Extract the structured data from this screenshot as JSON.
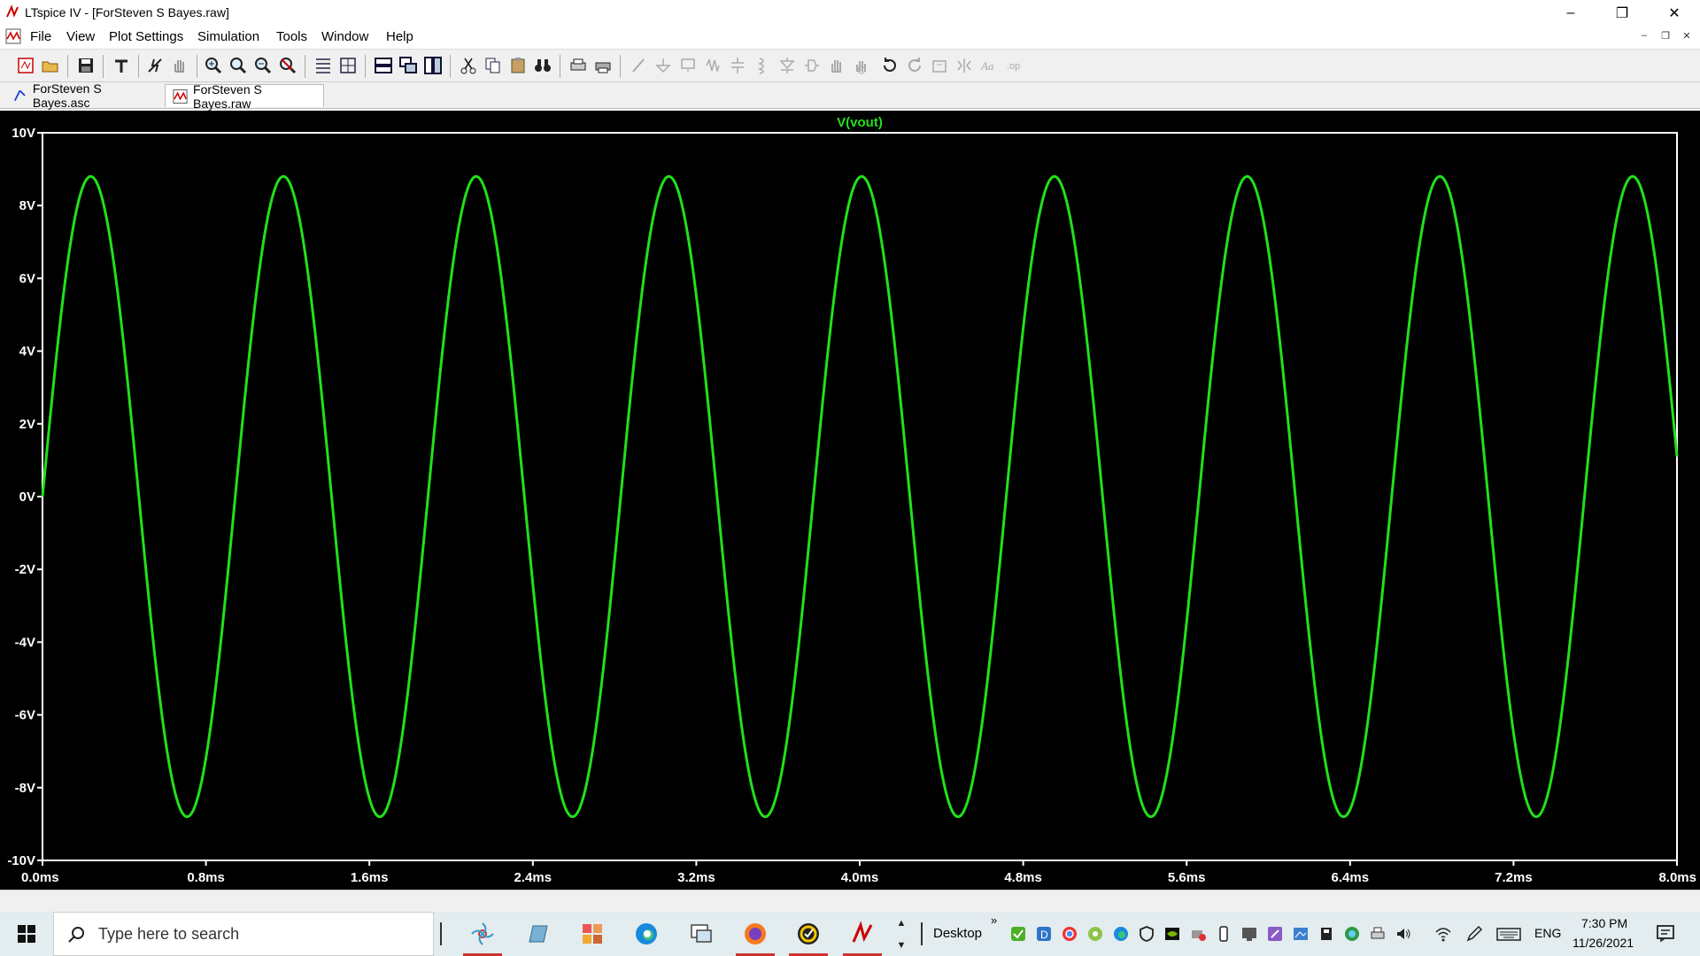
{
  "window": {
    "title": "LTspice IV - [ForSteven S Bayes.raw]",
    "controls": {
      "minimize": "–",
      "restore": "❐",
      "close": "✕"
    }
  },
  "menu": [
    "File",
    "View",
    "Plot Settings",
    "Simulation",
    "Tools",
    "Window",
    "Help"
  ],
  "mdi_controls": {
    "minimize": "–",
    "restore": "❐",
    "close": "✕"
  },
  "tabs": [
    {
      "label": "ForSteven S Bayes.asc",
      "icon": "schematic-icon",
      "active": false
    },
    {
      "label": "ForSteven S Bayes.raw",
      "icon": "waveform-icon",
      "active": true
    }
  ],
  "colors": {
    "trace": "#22e01a",
    "plot_bg": "#000000",
    "axis": "#ffffff",
    "title_text": "#22e01a"
  },
  "chart_data": {
    "type": "line",
    "title": "V(vout)",
    "series": [
      {
        "name": "V(vout)",
        "waveform": "sine",
        "amplitude_v": 8.8,
        "frequency_hz": 1060,
        "phase_deg": 0,
        "offset_v": 0
      }
    ],
    "x_range_ms": [
      0,
      8.0
    ],
    "y_range_v": [
      -10,
      10
    ],
    "x_ticks": [
      "0.0ms",
      "0.8ms",
      "1.6ms",
      "2.4ms",
      "3.2ms",
      "4.0ms",
      "4.8ms",
      "5.6ms",
      "6.4ms",
      "7.2ms",
      "8.0ms"
    ],
    "y_ticks": [
      "10V",
      "8V",
      "6V",
      "4V",
      "2V",
      "0V",
      "-2V",
      "-4V",
      "-6V",
      "-8V",
      "-10V"
    ],
    "grid": false
  },
  "taskbar": {
    "search_placeholder": "Type here to search",
    "desktop_label": "Desktop",
    "language": "ENG",
    "time": "7:30 PM",
    "date": "11/26/2021",
    "overflow": "»"
  }
}
